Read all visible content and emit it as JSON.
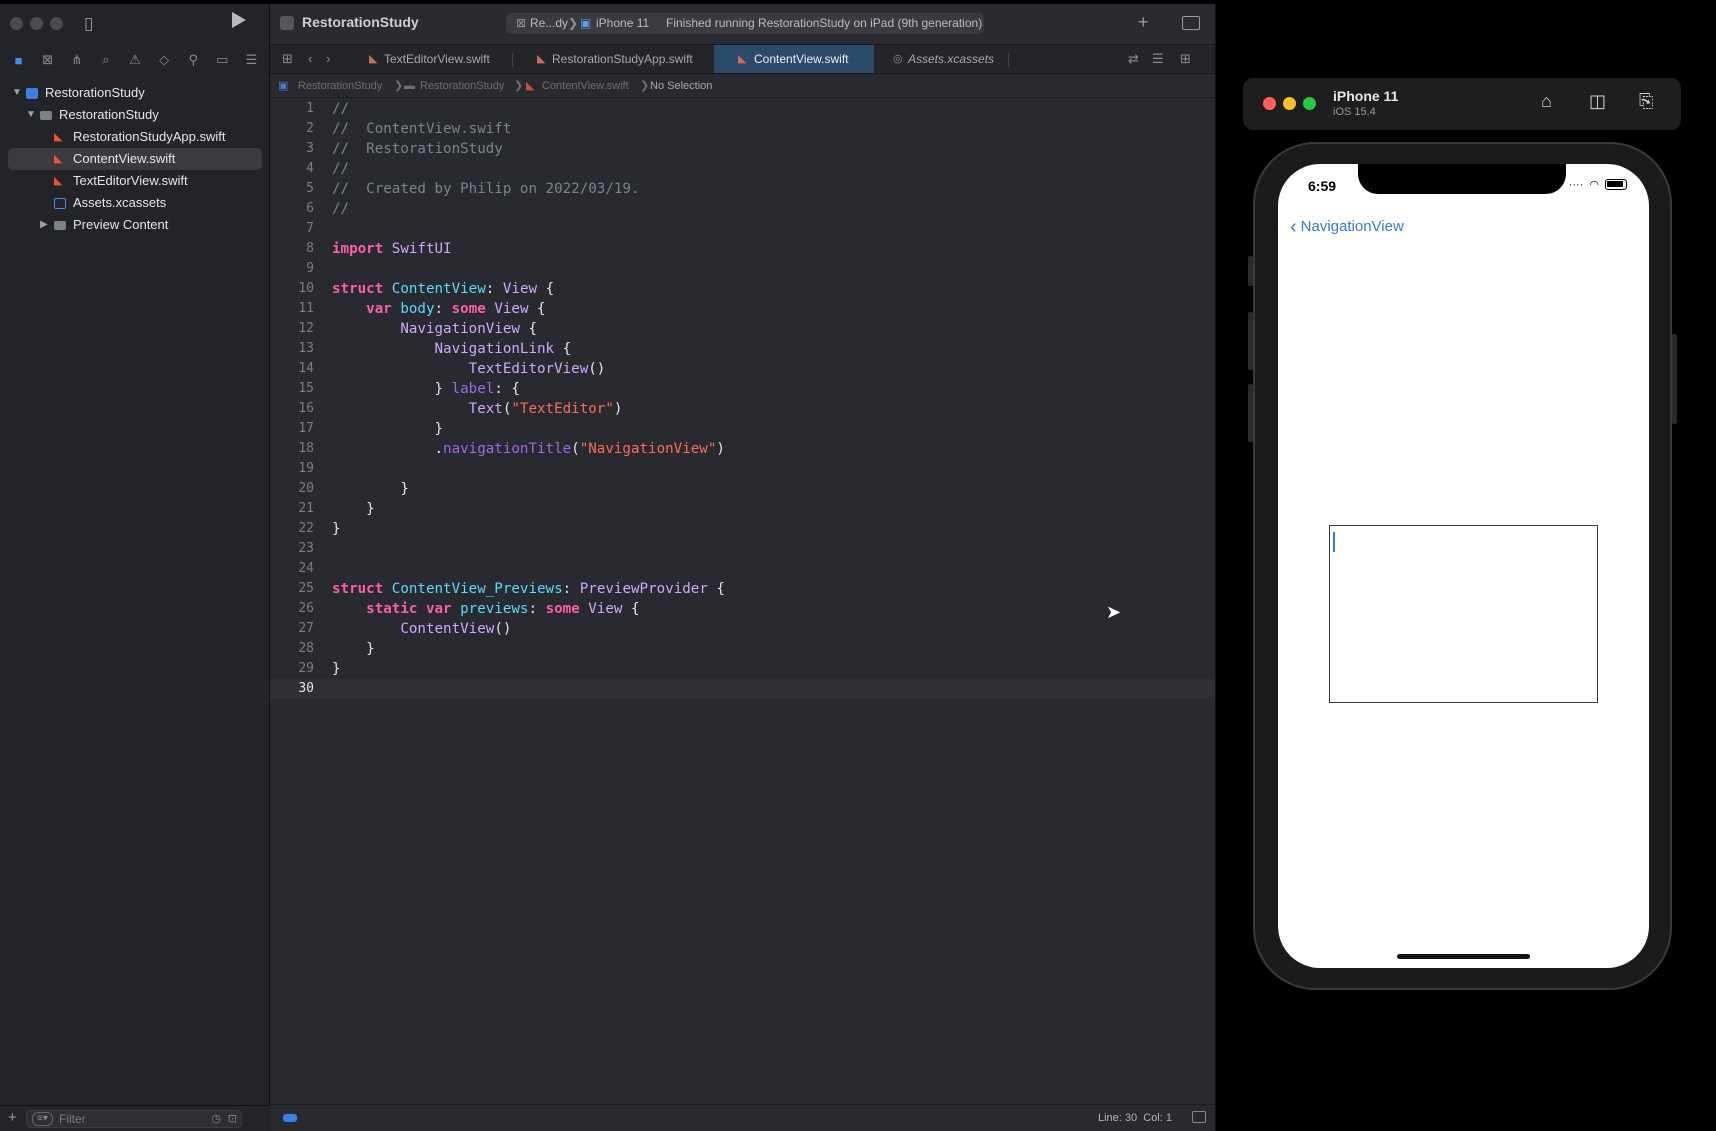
{
  "xcode": {
    "project_name": "RestorationStudy",
    "activity": {
      "scheme": "Re...dy",
      "separator": "❯",
      "device": "iPhone 11",
      "status": "Finished running RestorationStudy on iPad (9th generation)"
    },
    "sidebar": {
      "tree": [
        {
          "label": "RestorationStudy",
          "kind": "project"
        },
        {
          "label": "RestorationStudy",
          "kind": "folder"
        },
        {
          "label": "RestorationStudyApp.swift",
          "kind": "swift"
        },
        {
          "label": "ContentView.swift",
          "kind": "swift",
          "selected": true
        },
        {
          "label": "TextEditorView.swift",
          "kind": "swift"
        },
        {
          "label": "Assets.xcassets",
          "kind": "assets"
        },
        {
          "label": "Preview Content",
          "kind": "folder-collapsed"
        }
      ],
      "filter_placeholder": "Filter"
    },
    "tabs": [
      {
        "label": "TextEditorView.swift"
      },
      {
        "label": "RestorationStudyApp.swift"
      },
      {
        "label": "ContentView.swift",
        "active": true
      },
      {
        "label": "Assets.xcassets",
        "italic": true
      }
    ],
    "breadcrumb": [
      "RestorationStudy",
      "RestorationStudy",
      "ContentView.swift",
      "No Selection"
    ],
    "code_lines": [
      "//",
      "//  ContentView.swift",
      "//  RestorationStudy",
      "//",
      "//  Created by Philip on 2022/03/19.",
      "//",
      "",
      "import SwiftUI",
      "",
      "struct ContentView: View {",
      "    var body: some View {",
      "        NavigationView {",
      "            NavigationLink {",
      "                TextEditorView()",
      "            } label: {",
      "                Text(\"TextEditor\")",
      "            }",
      "            .navigationTitle(\"NavigationView\")",
      "",
      "        }",
      "    }",
      "}",
      "",
      "",
      "struct ContentView_Previews: PreviewProvider {",
      "    static var previews: some View {",
      "        ContentView()",
      "    }",
      "}",
      ""
    ],
    "status": {
      "line": "Line: 30",
      "col": "Col: 1"
    }
  },
  "simulator": {
    "device_name": "iPhone 11",
    "os_version": "iOS 15.4",
    "time": "6:59",
    "back_label": "NavigationView",
    "back_chevron": "‹"
  },
  "colors": {
    "accent_blue": "#2f7bd6",
    "swift_orange": "#f05138",
    "keyword_pink": "#fc5fa3",
    "string_red": "#fc6a5d"
  }
}
